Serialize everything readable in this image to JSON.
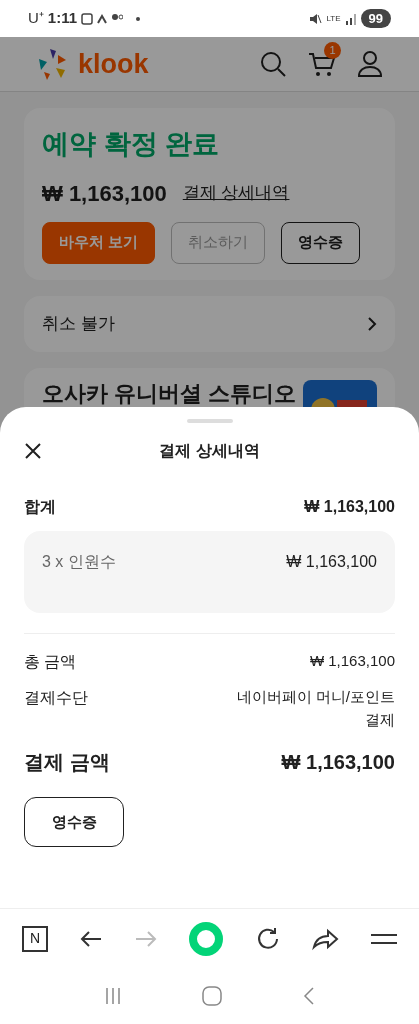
{
  "status_bar": {
    "carrier": "U⁺",
    "time": "1:11",
    "network": "LTE",
    "battery": "99"
  },
  "header": {
    "logo": "klook",
    "cart_count": "1"
  },
  "booking": {
    "status": "예약 확정 완료",
    "amount": "₩ 1,163,100",
    "details_link": "결제 상세내역",
    "buttons": [
      {
        "label": "바우처 보기",
        "kind": "primary",
        "disabled": false
      },
      {
        "label": "취소하기",
        "kind": "outline",
        "disabled": true
      },
      {
        "label": "영수증",
        "kind": "outline",
        "disabled": false
      }
    ]
  },
  "cancel_row": {
    "label": "취소 불가"
  },
  "product": {
    "title": "오사카 유니버셜 스튜디오"
  },
  "sheet": {
    "title": "결제 상세내역",
    "total_label": "합계",
    "total_value": "₩ 1,163,100",
    "items": [
      {
        "label": "3 x 인원수",
        "value": "₩ 1,163,100"
      }
    ],
    "rows": [
      {
        "label": "총 금액",
        "value": "₩ 1,163,100"
      },
      {
        "label": "결제수단",
        "value": "네이버페이 머니/포인트 결제"
      }
    ],
    "pay_label": "결제 금액",
    "pay_value": "₩ 1,163,100",
    "receipt_button": "영수증"
  },
  "browser_toolbar": {
    "tab_letter": "N",
    "forward_disabled": true
  }
}
